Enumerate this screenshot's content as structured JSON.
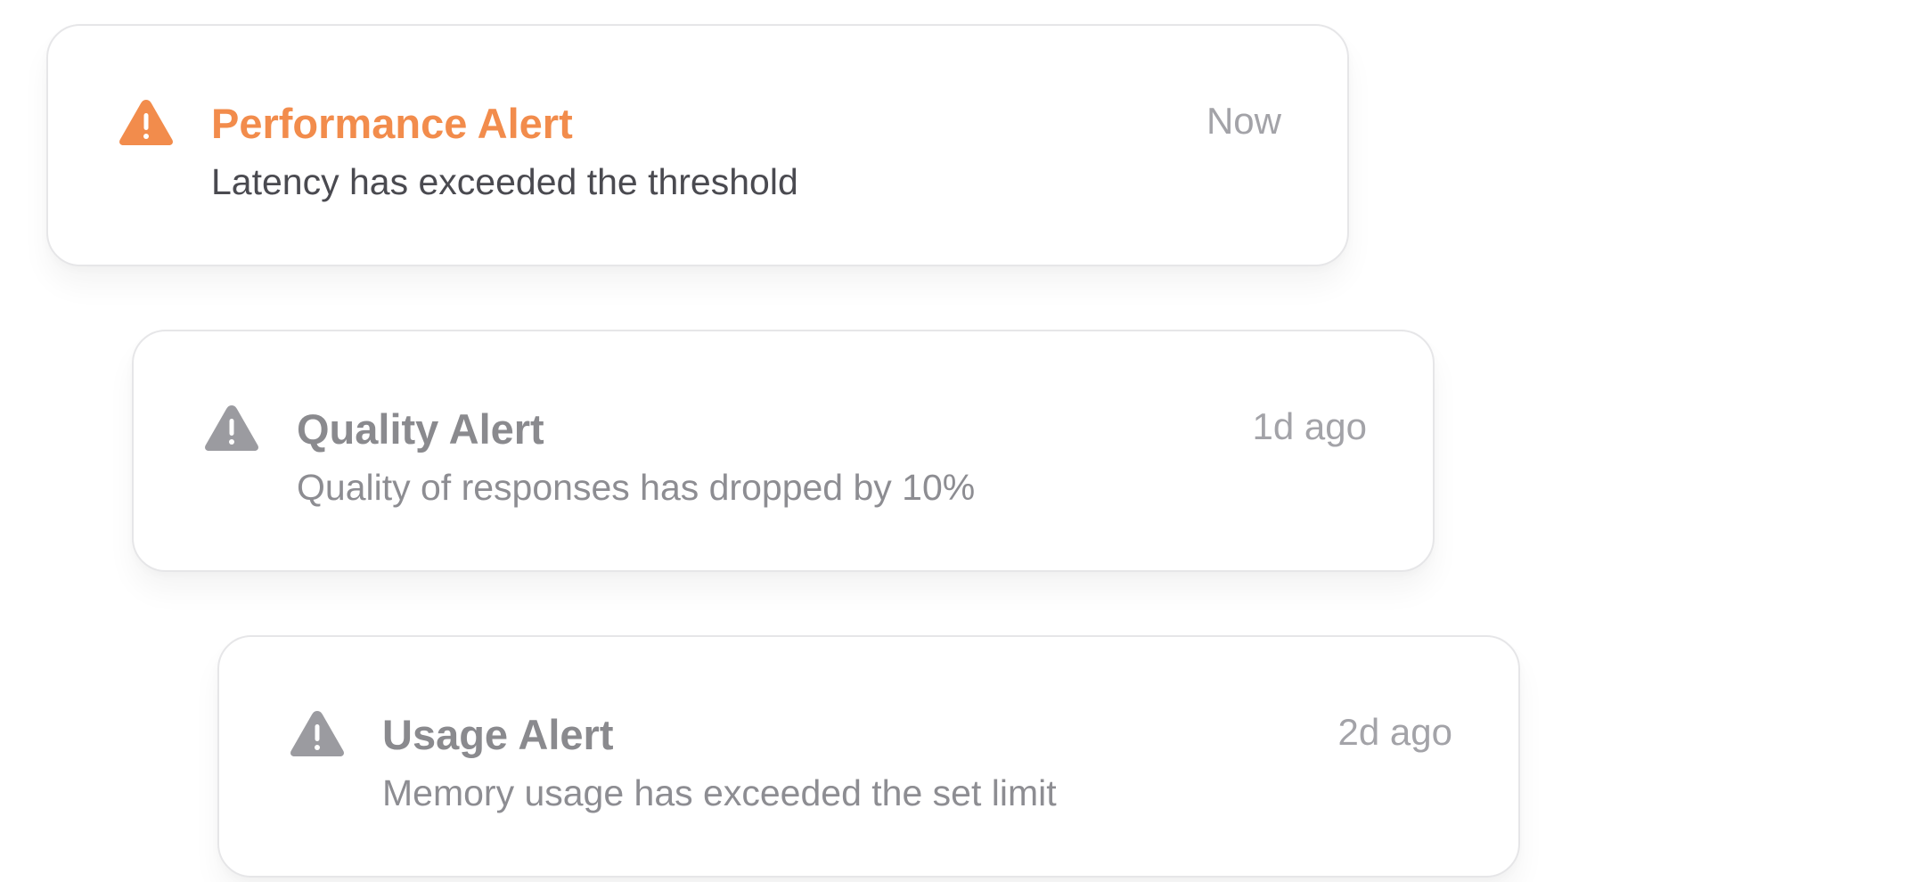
{
  "colors": {
    "active_accent": "#f28c4c",
    "muted_title": "#8a8a8e",
    "muted_text": "#8d8d92",
    "active_text": "#4a4a50",
    "muted_icon": "#9b9ba0",
    "timestamp": "#a3a3a8"
  },
  "alerts": [
    {
      "icon": "warning-triangle-icon",
      "title": "Performance Alert",
      "description": "Latency has exceeded the threshold",
      "time": "Now",
      "state": "active"
    },
    {
      "icon": "warning-triangle-icon",
      "title": "Quality Alert",
      "description": "Quality of responses has dropped by 10%",
      "time": "1d ago",
      "state": "muted"
    },
    {
      "icon": "warning-triangle-icon",
      "title": "Usage Alert",
      "description": "Memory usage has exceeded the set limit",
      "time": "2d ago",
      "state": "muted"
    }
  ]
}
